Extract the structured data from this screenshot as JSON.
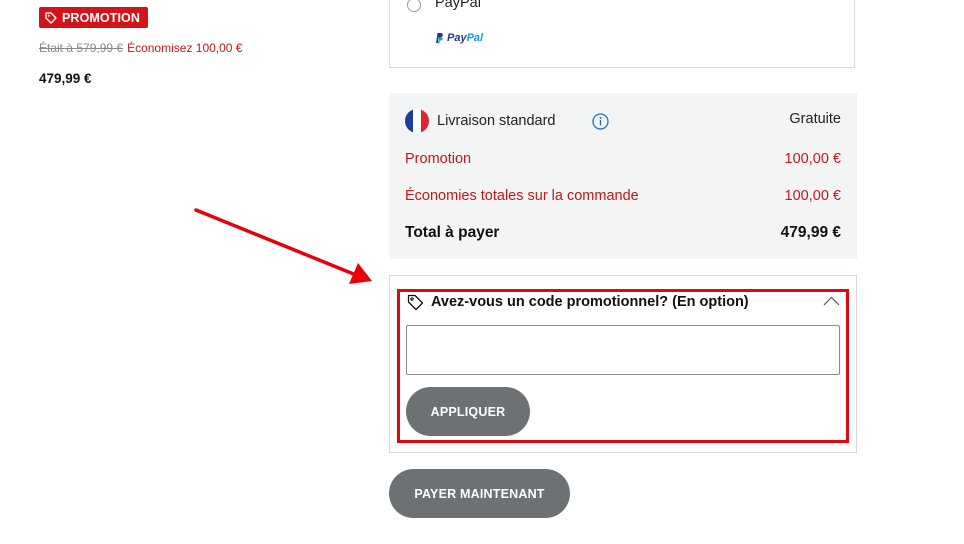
{
  "product": {
    "badge_label": "PROMOTION",
    "was_price": "Était à 579,99 €",
    "savings": "Économisez 100,00 €",
    "current_price": "479,99 €"
  },
  "payment": {
    "option_label": "PayPal",
    "logo_text_1": "Pay",
    "logo_text_2": "Pal"
  },
  "summary": {
    "shipping_label": "Livraison standard",
    "shipping_value": "Gratuite",
    "promotion_label": "Promotion",
    "promotion_value": "100,00 €",
    "total_savings_label": "Économies totales sur la commande",
    "total_savings_value": "100,00 €",
    "total_label": "Total à payer",
    "total_value": "479,99 €"
  },
  "promo_code": {
    "title": "Avez-vous un code promotionnel? (En option)",
    "input_value": "",
    "apply_label": "APPLIQUER"
  },
  "pay_now_label": "PAYER MAINTENANT",
  "colors": {
    "promo_red": "#d3151b",
    "highlight_red": "#e0070f",
    "button_gray": "#6e7173",
    "summary_bg": "#f3f4f4",
    "info_blue": "#1a73c8",
    "flag_blue": "#1b3f9c",
    "flag_red": "#e1232f"
  },
  "icons": {
    "badge": "tag-icon",
    "info": "info-icon",
    "promo_title": "tag-outline-icon",
    "collapse": "chevron-up-icon",
    "flag": "france-flag-icon",
    "annotation": "arrow-icon"
  }
}
